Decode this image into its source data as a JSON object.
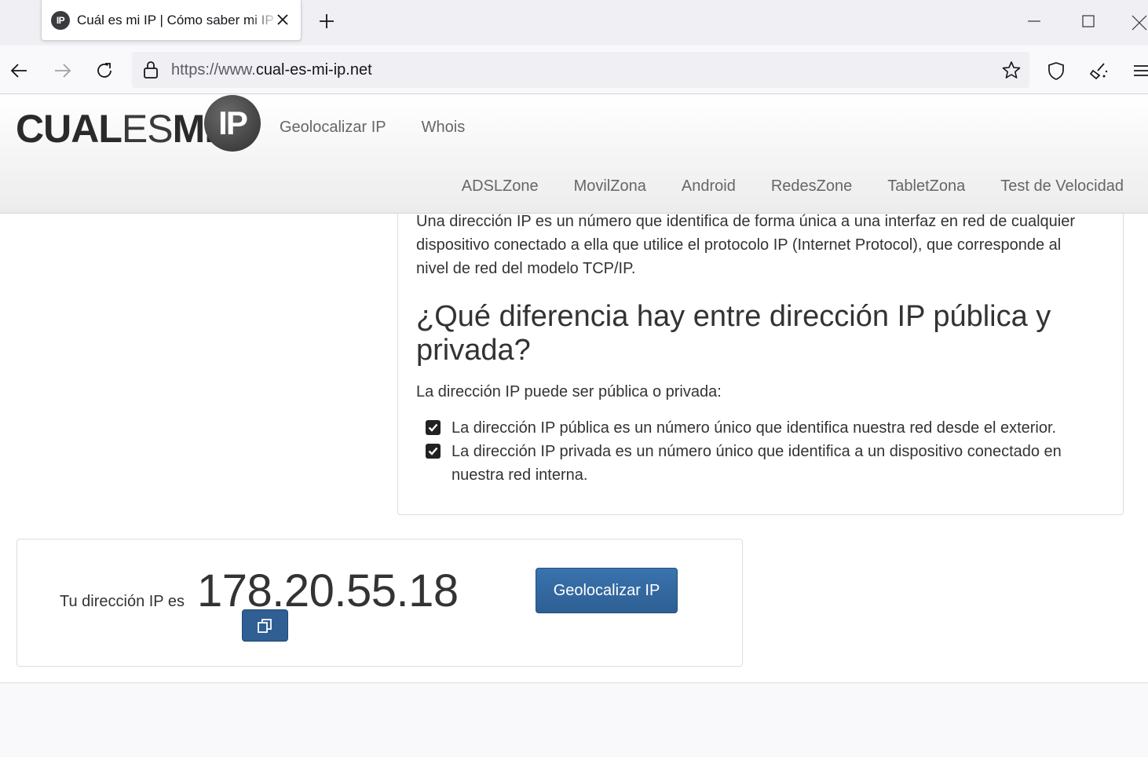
{
  "browser": {
    "tab": {
      "favicon_text": "IP",
      "title": "Cuál es mi IP | Cómo saber mi IP"
    },
    "url": {
      "prefix": "https://www.",
      "domain": "cual-es-mi-ip.net"
    }
  },
  "site": {
    "logo": {
      "bold": "CUAL",
      "thin": "ES",
      "bold2": "MI",
      "badge": "IP"
    },
    "primary_nav": [
      "Geolocalizar IP",
      "Whois"
    ],
    "secondary_nav": [
      "ADSLZone",
      "MovilZona",
      "Android",
      "RedesZone",
      "TabletZona",
      "Test de Velocidad"
    ]
  },
  "article": {
    "paragraph": "Una dirección IP es un número que identifica de forma única a una interfaz en red de cualquier dispositivo conectado a ella que utilice el protocolo IP (Internet Protocol), que corresponde al nivel de red del modelo TCP/IP.",
    "heading": "¿Qué diferencia hay entre dirección IP pública y privada?",
    "intro": "La dirección IP puede ser pública o privada:",
    "bullets": [
      "La dirección IP pública es un número único que identifica nuestra red desde el exterior.",
      "La dirección IP privada es un número único que identifica a un dispositivo conectado en nuestra red interna."
    ]
  },
  "ip_box": {
    "label": "Tu dirección IP es",
    "ip": "178.20.55.18",
    "geo_button": "Geolocalizar IP"
  },
  "colors": {
    "button": "#2f5f93",
    "text": "#333333",
    "nav": "#666666"
  }
}
